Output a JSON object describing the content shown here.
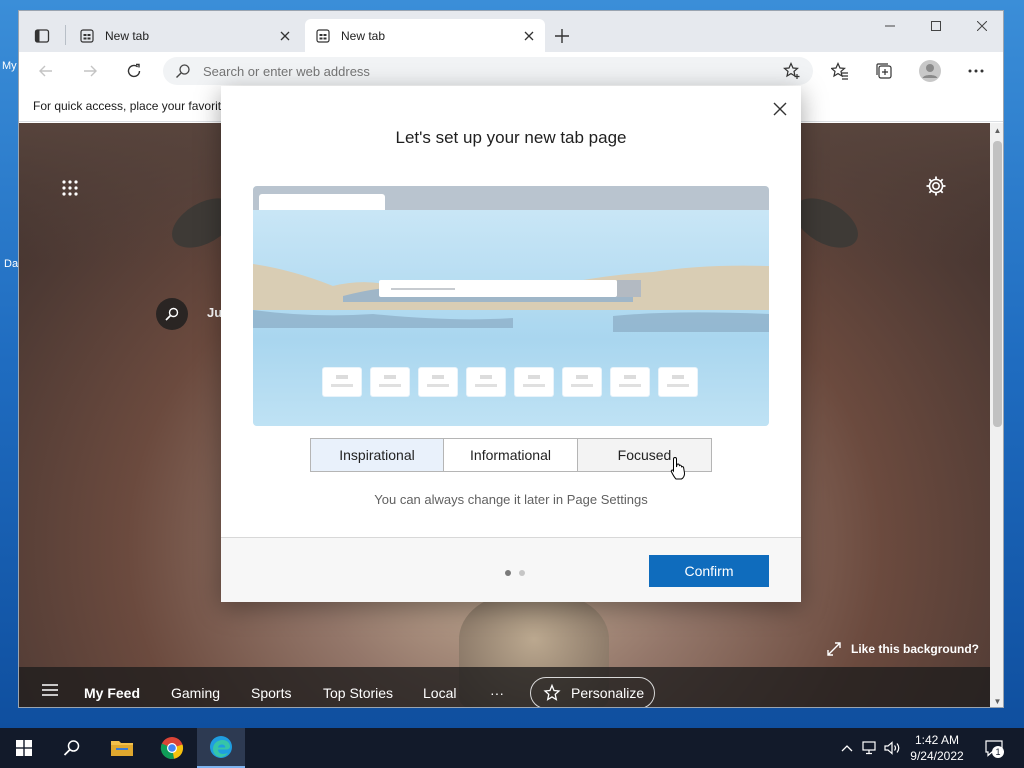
{
  "desktop": {
    "label_top": "My",
    "label_mid": "Da"
  },
  "tabs": [
    {
      "title": "New tab",
      "active": false
    },
    {
      "title": "New tab",
      "active": true
    }
  ],
  "address_bar": {
    "placeholder": "Search or enter web address",
    "value": ""
  },
  "favorites_bar": {
    "text": "For quick access, place your favorit"
  },
  "new_tab_page": {
    "search_text": "Ju",
    "like_background": "Like this background?",
    "feed": {
      "items": [
        "My Feed",
        "Gaming",
        "Sports",
        "Top Stories",
        "Local"
      ],
      "more": "···",
      "personalize": "Personalize"
    }
  },
  "dialog": {
    "title": "Let's set up your new tab page",
    "layouts": [
      "Inspirational",
      "Informational",
      "Focused"
    ],
    "selected_layout": "Inspirational",
    "hint": "You can always change it later in Page Settings",
    "confirm": "Confirm",
    "pages_total": 2,
    "current_page": 1
  },
  "taskbar": {
    "time": "1:42 AM",
    "date": "9/24/2022",
    "notification_count": "1"
  },
  "colors": {
    "accent": "#0f6cbd",
    "taskbar": "#121a2a",
    "selected_layout_bg": "#e9f1fb"
  }
}
